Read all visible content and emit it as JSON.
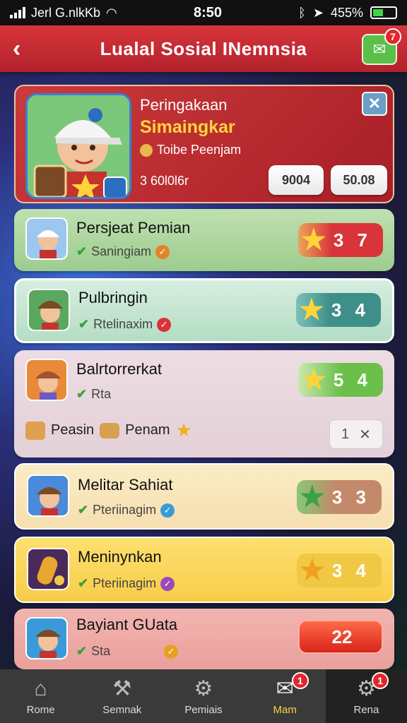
{
  "status_bar": {
    "carrier": "Jerl G.nlkKb",
    "time": "8:50",
    "battery": "455%",
    "battery_level": 0.45
  },
  "header": {
    "back_icon": "chevron-left-icon",
    "title": "Lualal Sosial INemnsia",
    "inbox_icon": "mail-check-icon",
    "inbox_badge": "7"
  },
  "hero": {
    "line1": "Peringakaan",
    "line2": "Simaingkar",
    "line3": "Toibe Peenjam",
    "line4": "3 60l0l6r",
    "btn1": "9004",
    "btn2": "50.08"
  },
  "rows": [
    {
      "name": "Persjeat Pemian",
      "sub": "Saningiam",
      "score": "3 7",
      "accent": "#d8343a"
    },
    {
      "name": "Pulbringin",
      "sub": "Rtelinaxim",
      "score": "3 4",
      "accent": "#3e8f8a"
    },
    {
      "name": "Balrtorrerkat",
      "sub": "Rta",
      "score": "5 4",
      "accent": "#6cc04a"
    },
    {
      "name": "Melitar Sahiat",
      "sub": "Pteriinagim",
      "score": "3 3",
      "accent": "#c4896a"
    },
    {
      "name": "Meninynkan",
      "sub": "Pteriinagim",
      "score": "3 4",
      "accent": "#f0c843"
    },
    {
      "name": "Bayiant GUata",
      "sub": "Sta",
      "score": "22",
      "accent": "#e23a2a"
    }
  ],
  "extra_row": {
    "label1": "Peasin",
    "label2": "Penam",
    "count": "1"
  },
  "nav": [
    {
      "label": "Rome",
      "icon": "home-icon"
    },
    {
      "label": "Semnak",
      "icon": "tools-icon"
    },
    {
      "label": "Pemiais",
      "icon": "gears-icon"
    },
    {
      "label": "Mam",
      "icon": "chat-icon",
      "badge": "1"
    },
    {
      "label": "Rena",
      "icon": "settings-icon",
      "badge": "1"
    }
  ]
}
